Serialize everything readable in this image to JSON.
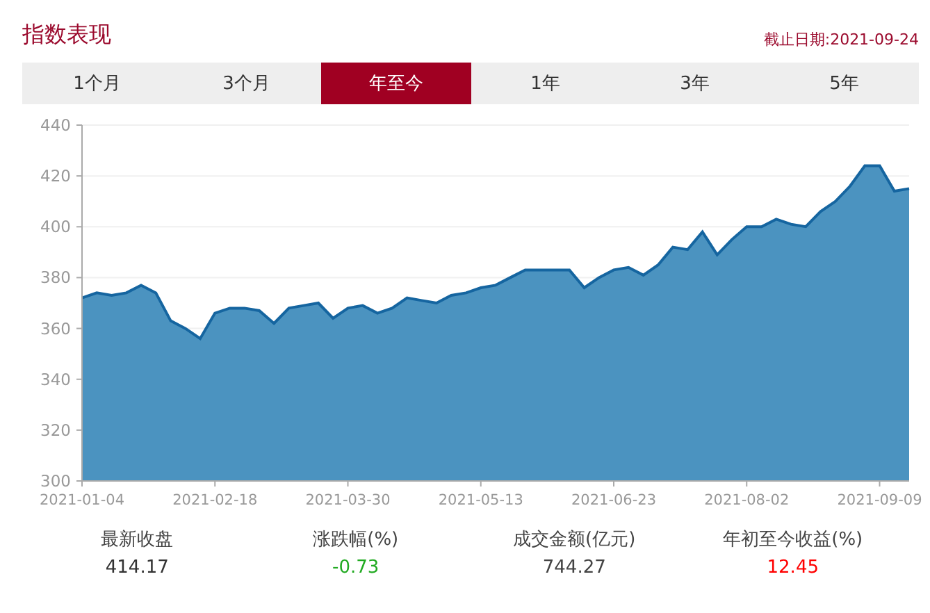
{
  "header": {
    "title": "指数表现",
    "as_of": "截止日期:2021-09-24"
  },
  "tabs": [
    {
      "label": "1个月",
      "selected": false
    },
    {
      "label": "3个月",
      "selected": false
    },
    {
      "label": "年至今",
      "selected": true
    },
    {
      "label": "1年",
      "selected": false
    },
    {
      "label": "3年",
      "selected": false
    },
    {
      "label": "5年",
      "selected": false
    }
  ],
  "chart": {
    "chart_data": {
      "type": "area",
      "grid": true,
      "ylim": [
        300,
        440
      ],
      "categories": [
        "2021-01-04",
        null,
        null,
        null,
        null,
        null,
        null,
        null,
        null,
        "2021-02-18",
        null,
        null,
        null,
        null,
        null,
        null,
        null,
        null,
        "2021-03-30",
        null,
        null,
        null,
        null,
        null,
        null,
        null,
        null,
        "2021-05-13",
        null,
        null,
        null,
        null,
        null,
        null,
        null,
        null,
        "2021-06-23",
        null,
        null,
        null,
        null,
        null,
        null,
        null,
        null,
        "2021-08-02",
        null,
        null,
        null,
        null,
        null,
        null,
        null,
        null,
        "2021-09-09",
        null,
        null
      ],
      "yticks": [
        300,
        320,
        340,
        360,
        380,
        400,
        420,
        440
      ],
      "series": [
        {
          "color": "#4b93c0",
          "values": [
            372,
            374,
            373,
            374,
            377,
            374,
            363,
            360,
            356,
            366,
            368,
            368,
            367,
            362,
            368,
            369,
            370,
            364,
            368,
            369,
            366,
            368,
            372,
            371,
            370,
            373,
            374,
            376,
            377,
            380,
            383,
            383,
            383,
            383,
            376,
            380,
            383,
            384,
            381,
            385,
            392,
            391,
            398,
            389,
            395,
            400,
            400,
            403,
            401,
            400,
            406,
            410,
            416,
            424,
            424,
            414,
            415
          ]
        }
      ]
    }
  },
  "stats": [
    {
      "label": "最新收盘",
      "value": "414.17",
      "color": "#333333"
    },
    {
      "label": "涨跌幅(%)",
      "value": "-0.73",
      "color": "#22aa22"
    },
    {
      "label": "成交金额(亿元)",
      "value": "744.27",
      "color": "#444444"
    },
    {
      "label": "年初至今收益(%)",
      "value": "12.45",
      "color": "#ff0000"
    }
  ]
}
